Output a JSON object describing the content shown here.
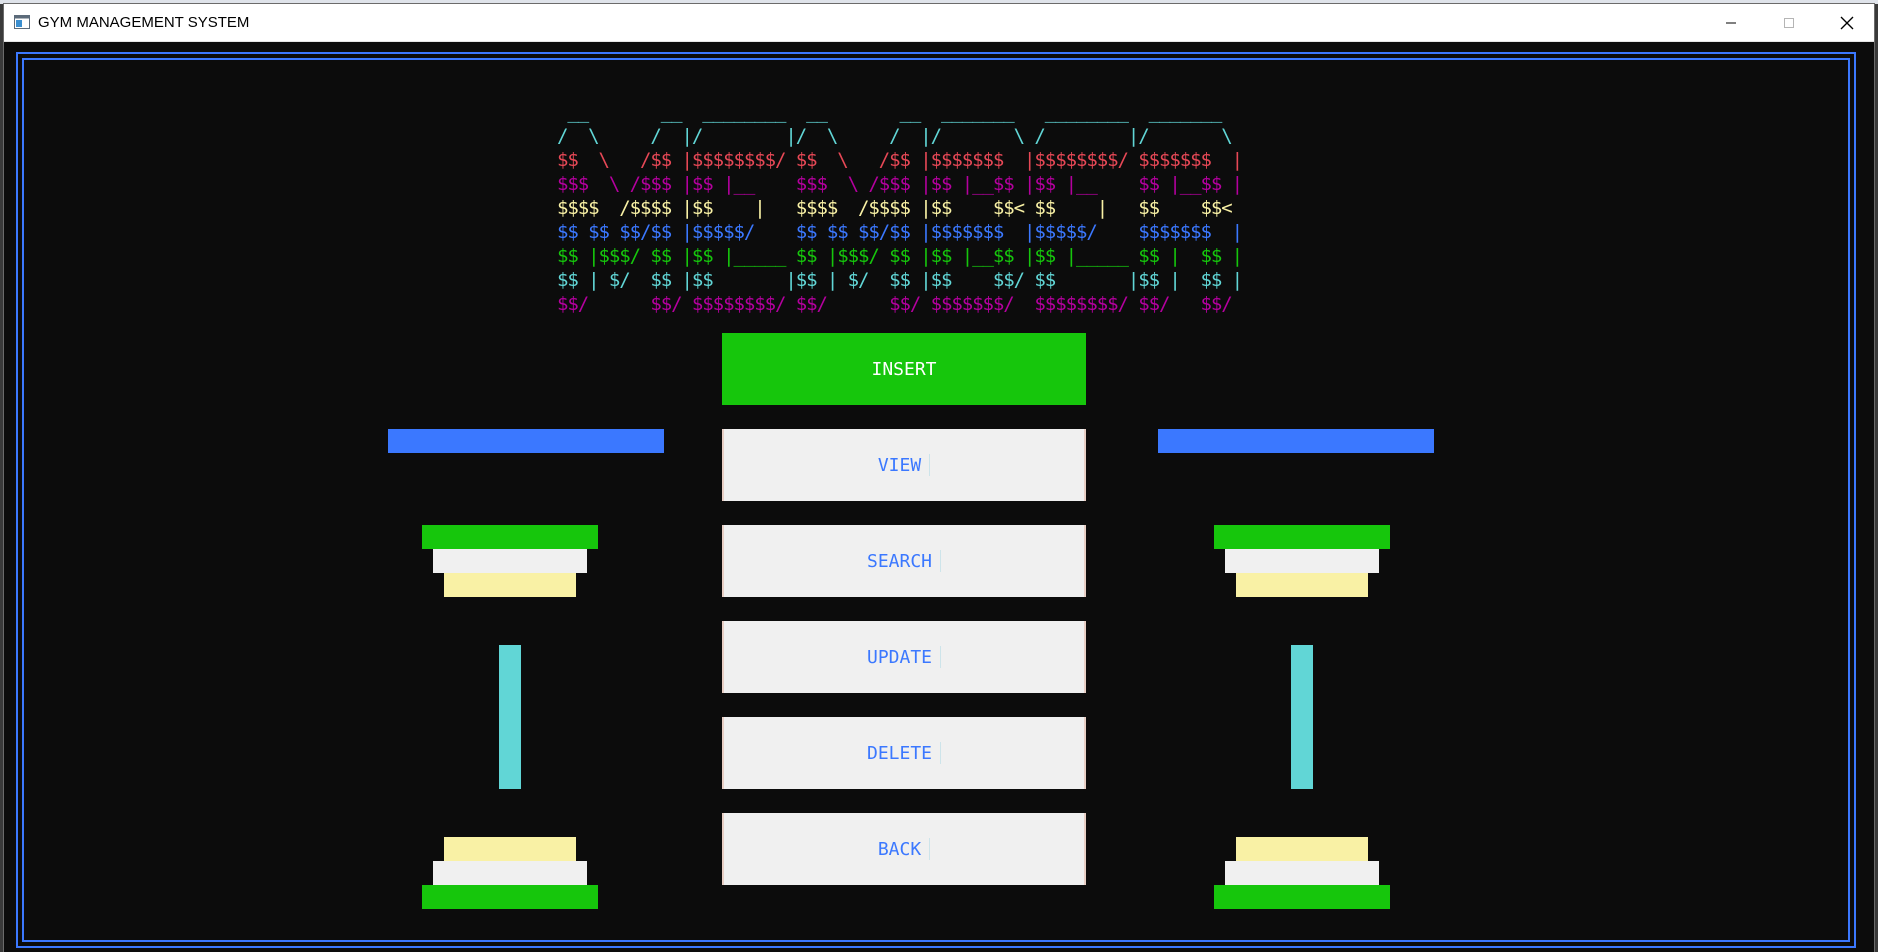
{
  "window": {
    "title": "GYM MANAGEMENT SYSTEM",
    "background": "#0c0c0c",
    "frame_color": "#3b78ff",
    "controls": {
      "minimize": "minimize",
      "maximize": "maximize",
      "close": "close"
    }
  },
  "banner": {
    "lines": [
      {
        "text": " __       __  ________  __       __  _______   ________  _______  ",
        "color": "#61d6d6"
      },
      {
        "text": "/  \\     /  |/        |/  \\     /  |/       \\ /        |/       \\ ",
        "color": "#61d6d6"
      },
      {
        "text": "$$  \\   /$$ |$$$$$$$$/ $$  \\   /$$ |$$$$$$$  |$$$$$$$$/ $$$$$$$  |",
        "color": "#e74856"
      },
      {
        "text": "$$$  \\ /$$$ |$$ |__    $$$  \\ /$$$ |$$ |__$$ |$$ |__    $$ |__$$ |",
        "color": "#b4009e"
      },
      {
        "text": "$$$$  /$$$$ |$$    |   $$$$  /$$$$ |$$    $$< $$    |   $$    $$< ",
        "color": "#f9f1a5"
      },
      {
        "text": "$$ $$ $$/$$ |$$$$$/    $$ $$ $$/$$ |$$$$$$$  |$$$$$/    $$$$$$$  |",
        "color": "#3b78ff"
      },
      {
        "text": "$$ |$$$/ $$ |$$ |_____ $$ |$$$/ $$ |$$ |__$$ |$$ |_____ $$ |  $$ |",
        "color": "#16c60c"
      },
      {
        "text": "$$ | $/  $$ |$$       |$$ | $/  $$ |$$    $$/ $$       |$$ |  $$ |",
        "color": "#61d6d6"
      },
      {
        "text": "$$/      $$/ $$$$$$$$/ $$/      $$/ $$$$$$$/  $$$$$$$$/ $$/   $$/ ",
        "color": "#b4009e"
      }
    ]
  },
  "menu": {
    "buttons": [
      {
        "label": "INSERT",
        "name": "insert-button",
        "active": true
      },
      {
        "label": "VIEW",
        "name": "view-button",
        "active": false
      },
      {
        "label": "SEARCH",
        "name": "search-button",
        "active": false
      },
      {
        "label": "UPDATE",
        "name": "update-button",
        "active": false
      },
      {
        "label": "DELETE",
        "name": "delete-button",
        "active": false
      },
      {
        "label": "BACK",
        "name": "back-button",
        "active": false
      }
    ]
  },
  "decoration": {
    "colors": {
      "blue": "#3b78ff",
      "green": "#16c60c",
      "white": "#f0f0f0",
      "yellow": "#f9f1a5",
      "cyan": "#61d6d6"
    }
  }
}
